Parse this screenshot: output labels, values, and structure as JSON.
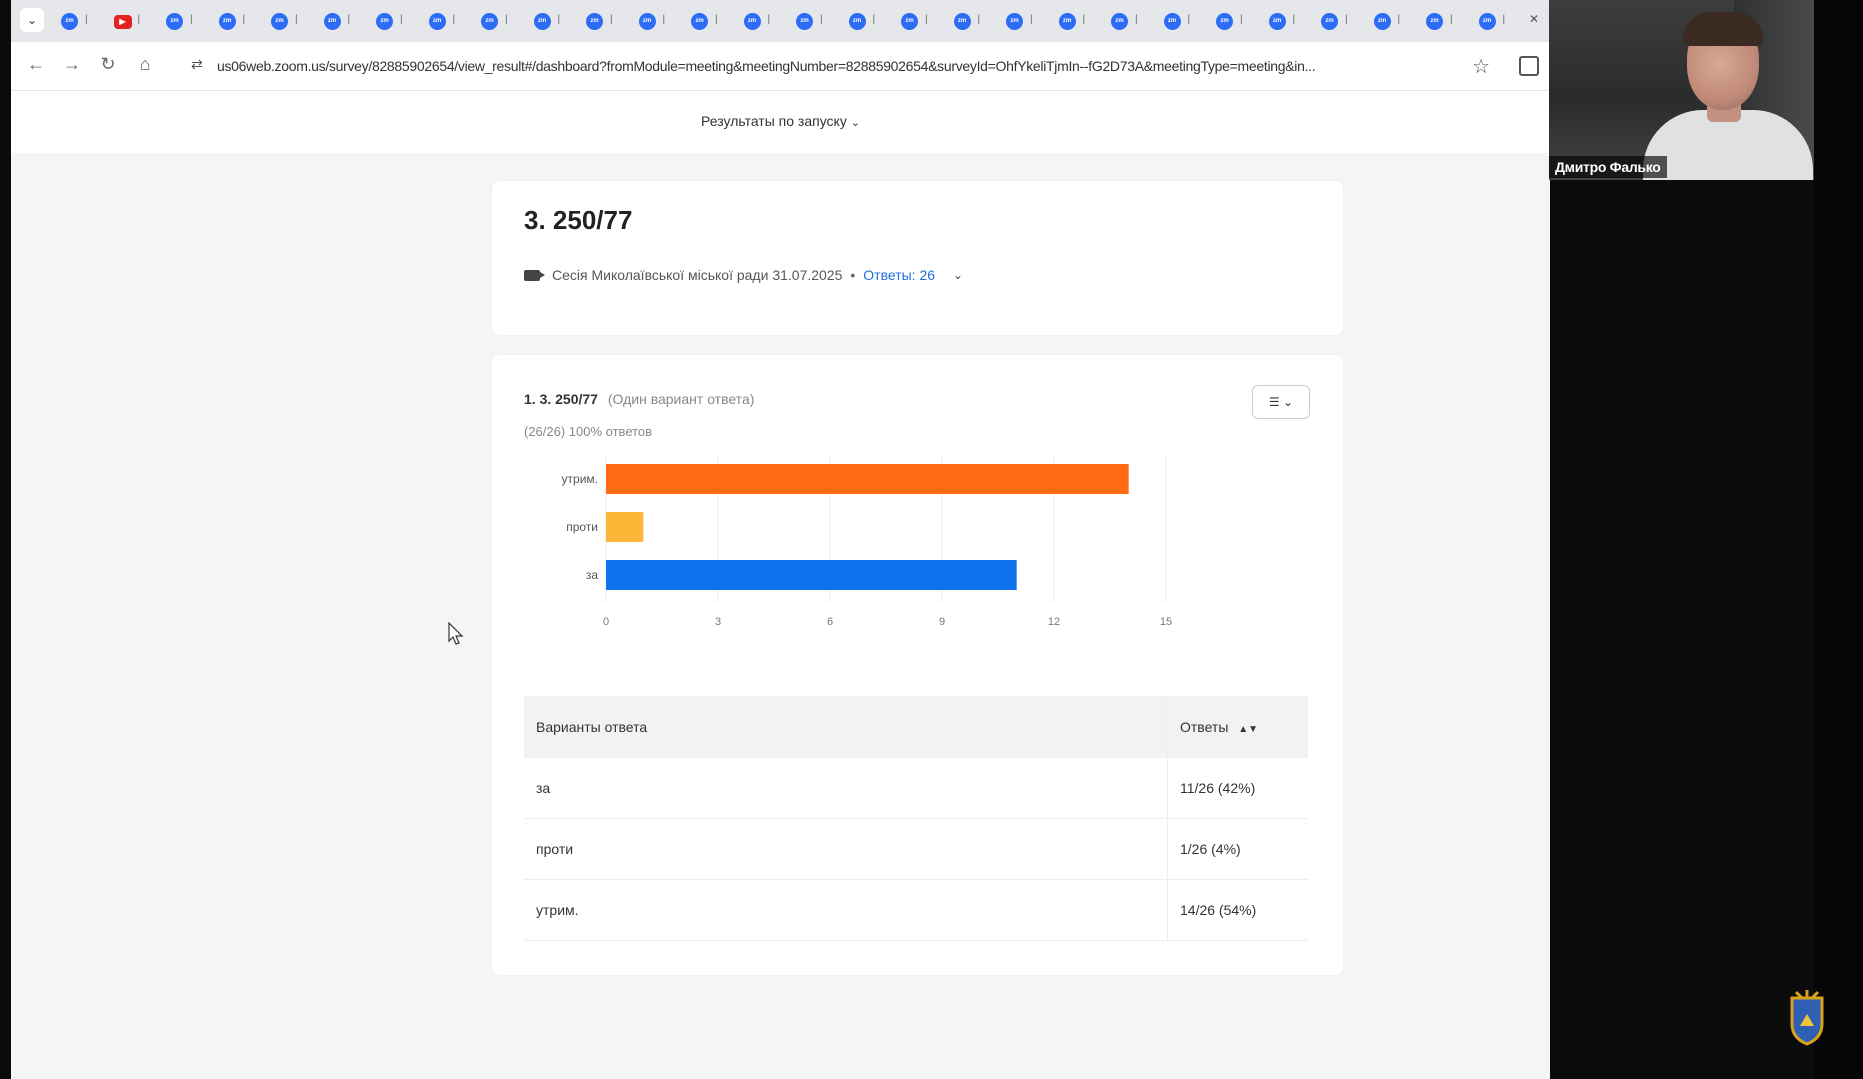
{
  "browser": {
    "url": "us06web.zoom.us/survey/82885902654/view_result#/dashboard?fromModule=meeting&meetingNumber=82885902654&surveyId=OhfYkeliTjmIn--fG2D73A&meetingType=meeting&in...",
    "tab_count": 28
  },
  "page": {
    "results_switch": "Результаты по запуску"
  },
  "survey": {
    "title": "3. 250/77",
    "session": "Сесія Миколаївської міської ради 31.07.2025",
    "answers_link": "Ответы: 26"
  },
  "question": {
    "label": "1. 3. 250/77",
    "type": "(Один вариант ответа)",
    "count": "(26/26) 100% ответов"
  },
  "chart_data": {
    "type": "bar",
    "orientation": "horizontal",
    "categories": [
      "утрим.",
      "проти",
      "за"
    ],
    "values": [
      14,
      1,
      11
    ],
    "colors": [
      "#ff6a13",
      "#fdb738",
      "#0e72ed"
    ],
    "xlim": [
      0,
      15
    ],
    "xticks": [
      0,
      3,
      6,
      9,
      12,
      15
    ],
    "grid": true
  },
  "table": {
    "headers": [
      "Варианты ответа",
      "Ответы"
    ],
    "rows": [
      [
        "за",
        "11/26 (42%)"
      ],
      [
        "проти",
        "1/26 (4%)"
      ],
      [
        "утрим.",
        "14/26 (54%)"
      ]
    ]
  },
  "participant": {
    "name": "Дмитро Фалько"
  }
}
